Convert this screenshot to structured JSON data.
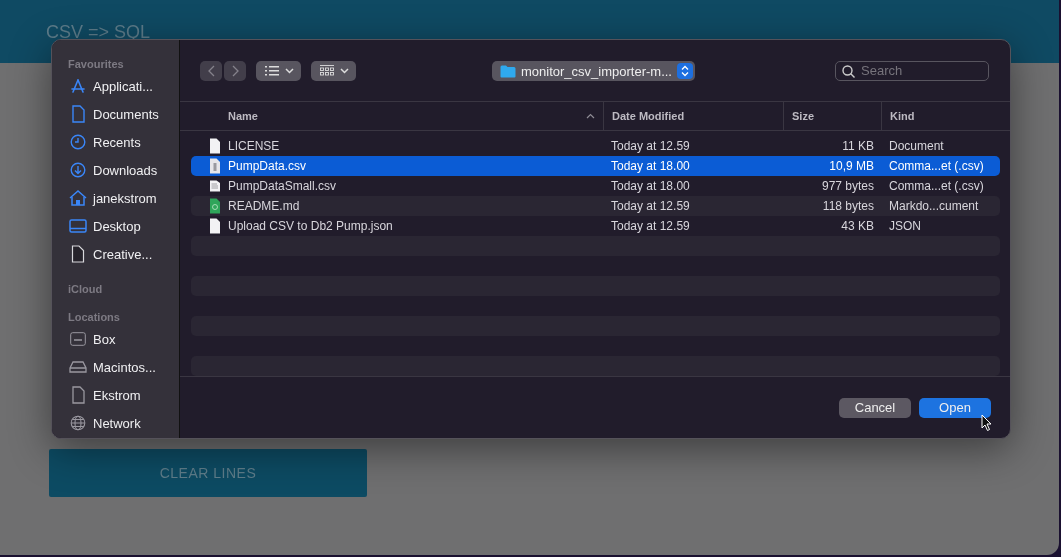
{
  "app": {
    "title": "CSV => SQL",
    "clear_button": "CLEAR LINES"
  },
  "dialog": {
    "sidebar": [
      {
        "heading": "Favourites",
        "items": [
          {
            "label": "Applicati...",
            "kind": "apps"
          },
          {
            "label": "Documents",
            "kind": "document"
          },
          {
            "label": "Recents",
            "kind": "clock"
          },
          {
            "label": "Downloads",
            "kind": "download"
          },
          {
            "label": "janekstrom",
            "kind": "home"
          },
          {
            "label": "Desktop",
            "kind": "desktop"
          },
          {
            "label": "Creative...",
            "kind": "file"
          }
        ]
      },
      {
        "heading": "iCloud"
      },
      {
        "heading": "Locations",
        "items": [
          {
            "label": "Box",
            "kind": "box"
          },
          {
            "label": "Macintos...",
            "kind": "drive"
          },
          {
            "label": "Ekstrom",
            "kind": "plain"
          },
          {
            "label": "Network",
            "kind": "globe"
          }
        ]
      }
    ],
    "toolbar": {
      "back_disabled": true,
      "forward_disabled": true,
      "folder": "monitor_csv_importer-m...",
      "search_placeholder": "Search"
    },
    "columns": [
      "Name",
      "Date Modified",
      "Size",
      "Kind"
    ],
    "files": [
      {
        "name": "LICENSE",
        "date": "Today at 12.59",
        "size": "11 KB",
        "type": "Document",
        "kind": "document",
        "selected": false
      },
      {
        "name": "PumpData.csv",
        "date": "Today at 18.00",
        "size": "10,9 MB",
        "type": "Comma...et (.csv)",
        "kind": "csv",
        "selected": true
      },
      {
        "name": "PumpDataSmall.csv",
        "date": "Today at 18.00",
        "size": "977 bytes",
        "type": "Comma...et (.csv)",
        "kind": "csv-small",
        "selected": false
      },
      {
        "name": "README.md",
        "date": "Today at 12.59",
        "size": "118 bytes",
        "type": "Markdo...cument",
        "kind": "markdown",
        "selected": false
      },
      {
        "name": "Upload CSV to Db2 Pump.json",
        "date": "Today at 12.59",
        "size": "43 KB",
        "type": "JSON",
        "kind": "document",
        "selected": false
      }
    ],
    "buttons": [
      {
        "label": "Cancel",
        "kind": "secondary"
      },
      {
        "label": "Open",
        "kind": "primary"
      }
    ]
  }
}
